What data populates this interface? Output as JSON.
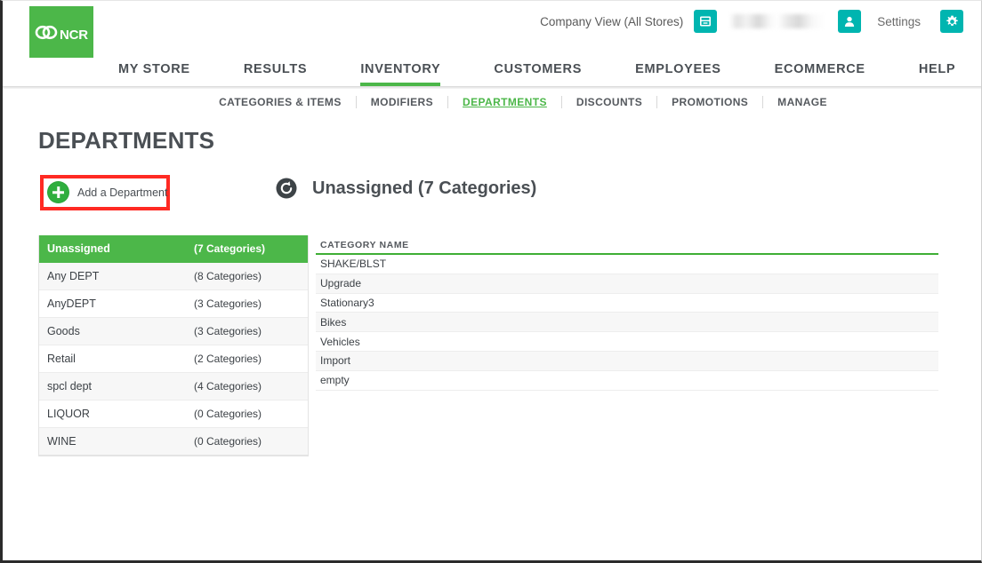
{
  "header": {
    "logo_text": "NCR",
    "logo_icon": "ncr-interlocking-rings-logo",
    "company_view_label": "Company View (All Stores)",
    "store_icon": "store-register-icon",
    "user_name": "",
    "user_icon": "user-person-icon",
    "settings_label": "Settings",
    "gear_icon": "gear-icon"
  },
  "main_nav": [
    {
      "label": "MY STORE",
      "active": false
    },
    {
      "label": "RESULTS",
      "active": false
    },
    {
      "label": "INVENTORY",
      "active": true
    },
    {
      "label": "CUSTOMERS",
      "active": false
    },
    {
      "label": "EMPLOYEES",
      "active": false
    },
    {
      "label": "ECOMMERCE",
      "active": false
    },
    {
      "label": "HELP",
      "active": false
    }
  ],
  "sub_nav": [
    {
      "label": "CATEGORIES & ITEMS",
      "active": false
    },
    {
      "label": "MODIFIERS",
      "active": false
    },
    {
      "label": "DEPARTMENTS",
      "active": true
    },
    {
      "label": "DISCOUNTS",
      "active": false
    },
    {
      "label": "PROMOTIONS",
      "active": false
    },
    {
      "label": "MANAGE",
      "active": false
    }
  ],
  "page": {
    "title": "DEPARTMENTS",
    "add_department_label": "Add a Department",
    "add_department_icon": "plus-circle-icon",
    "refresh_icon": "refresh-icon",
    "selected_department_heading": "Unassigned (7 Categories)"
  },
  "department_list": [
    {
      "name": "Unassigned",
      "count": "(7 Categories)",
      "selected": true
    },
    {
      "name": "Any DEPT",
      "count": "(8 Categories)",
      "selected": false
    },
    {
      "name": "AnyDEPT",
      "count": "(3 Categories)",
      "selected": false
    },
    {
      "name": "Goods",
      "count": "(3 Categories)",
      "selected": false
    },
    {
      "name": "Retail",
      "count": "(2 Categories)",
      "selected": false
    },
    {
      "name": "spcl dept",
      "count": "(4 Categories)",
      "selected": false
    },
    {
      "name": "LIQUOR",
      "count": "(0 Categories)",
      "selected": false
    },
    {
      "name": "WINE",
      "count": "(0 Categories)",
      "selected": false
    }
  ],
  "category_table": {
    "header": "CATEGORY NAME",
    "rows": [
      {
        "name": "SHAKE/BLST"
      },
      {
        "name": "Upgrade"
      },
      {
        "name": "Stationary3"
      },
      {
        "name": "Bikes"
      },
      {
        "name": "Vehicles"
      },
      {
        "name": "Import"
      },
      {
        "name": "empty"
      }
    ]
  },
  "colors": {
    "brand_green": "#4CB749",
    "teal": "#00B5B0",
    "annotation_red": "#FF2A23",
    "text_dark": "#4a4f54"
  }
}
